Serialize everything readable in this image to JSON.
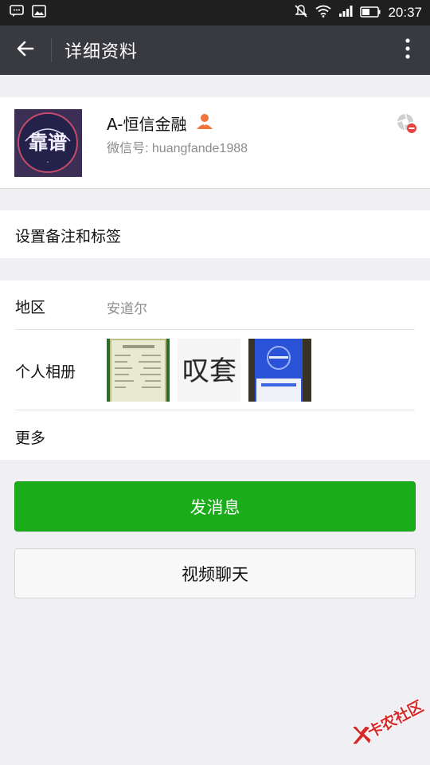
{
  "status_bar": {
    "time": "20:37",
    "left_icons": [
      "message-icon",
      "image-icon"
    ],
    "right_icons": [
      "mute-icon",
      "wifi-icon",
      "signal-icon",
      "battery-icon"
    ]
  },
  "app_bar": {
    "title": "详细资料",
    "back_icon": "arrow-left-icon",
    "more_icon": "more-vertical-icon"
  },
  "profile": {
    "name": "A-恒信金融",
    "wechat_id": "微信号: huangfande1988",
    "avatar_icon": "avatar-image",
    "gender_icon": "person-icon",
    "camera_icon": "camera-icon",
    "colors": {
      "gender": "#f0743b",
      "camera_badge": "#e64340"
    }
  },
  "remark": {
    "label": "设置备注和标签"
  },
  "info": {
    "region_label": "地区",
    "region_value": "安道尔",
    "album_label": "个人相册",
    "album_thumbs": [
      "thumb-receipt",
      "thumb-text",
      "thumb-phone"
    ],
    "thumb2_text": "叹套",
    "more_label": "更多"
  },
  "actions": {
    "send_message": "发消息",
    "video_chat": "视频聊天",
    "colors": {
      "primary": "#1aad19"
    }
  },
  "watermark": {
    "text": "卡农社区"
  }
}
